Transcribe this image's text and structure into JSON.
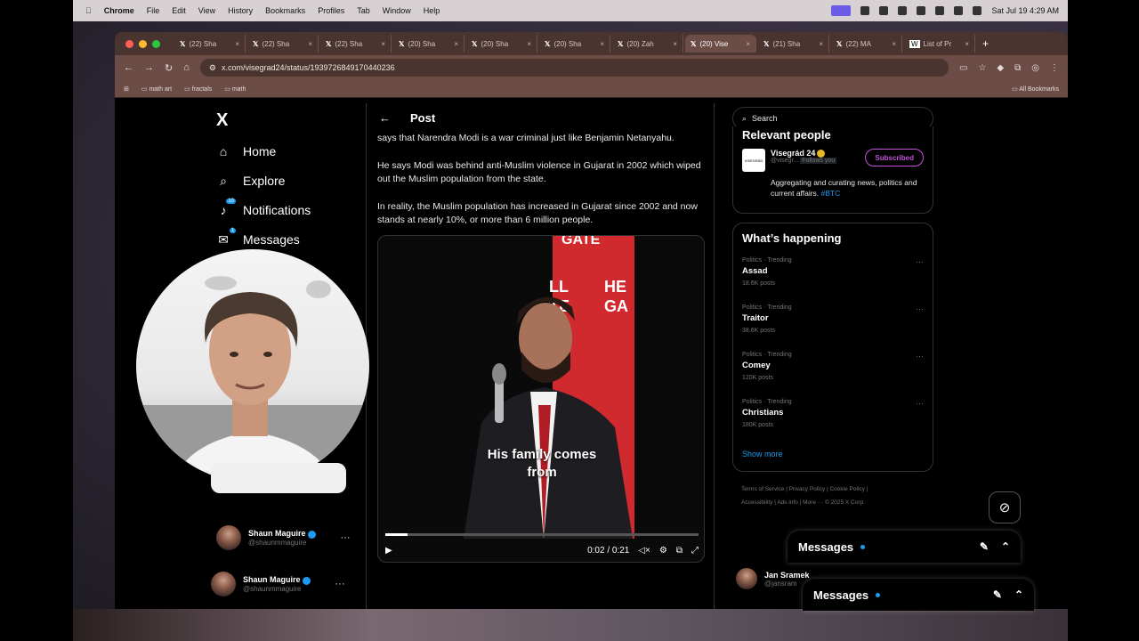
{
  "menubar": {
    "app": "Chrome",
    "items": [
      "File",
      "Edit",
      "View",
      "History",
      "Bookmarks",
      "Profiles",
      "Tab",
      "Window",
      "Help"
    ],
    "clock": "Sat Jul 19  4:29 AM"
  },
  "tabs": [
    {
      "label": "(22) Sha"
    },
    {
      "label": "(22) Sha"
    },
    {
      "label": "(22) Sha"
    },
    {
      "label": "(20) Sha"
    },
    {
      "label": "(20) Sha"
    },
    {
      "label": "(20) Sha"
    },
    {
      "label": "(20) Zah"
    },
    {
      "label": "(20) Vise"
    },
    {
      "label": "(21) Sha"
    },
    {
      "label": "(22) MA"
    },
    {
      "label": "List of Pr"
    }
  ],
  "address": {
    "url": "x.com/visegrad24/status/1939726849170440236"
  },
  "bookmarks": {
    "items": [
      "math art",
      "fractals",
      "math"
    ],
    "all": "All Bookmarks"
  },
  "nav": {
    "logo": "X",
    "home": "Home",
    "explore": "Explore",
    "notifications": "Notifications",
    "notif_badge": "10",
    "messages": "Messages",
    "msg_badge": "1"
  },
  "post": {
    "header": "Post",
    "paragraphs": [
      "says that Narendra Modi is a war criminal just like Benjamin Netanyahu.",
      "He says Modi was behind anti-Muslim violence in Gujarat in 2002 which wiped out the Muslim population from the state.",
      "In reality, the Muslim population has increased in Gujarat since 2002 and now stands at nearly 10%, or more than 6 million people."
    ],
    "video": {
      "caption_line1": "His family comes",
      "caption_line2": "from",
      "time": "0:02 / 0:21",
      "progress": 0.07,
      "banner_top": "GATE",
      "banner_left": "LL\nTE",
      "banner_right": "HE\nGA"
    }
  },
  "search": {
    "placeholder": "Search"
  },
  "relevant": {
    "title": "Relevant people",
    "name": "Visegrád 24",
    "handle": "@visegr...",
    "follows": "Follows you",
    "button": "Subscribed",
    "bio": "Aggregating and curating news, politics and current affairs.",
    "bio_tag": "#BTC"
  },
  "happening": {
    "title": "What’s happening",
    "trends": [
      {
        "category": "Politics · Trending",
        "name": "Assad",
        "posts": "18.6K posts"
      },
      {
        "category": "Politics · Trending",
        "name": "Traitor",
        "posts": "38.6K posts"
      },
      {
        "category": "Politics · Trending",
        "name": "Comey",
        "posts": "120K posts"
      },
      {
        "category": "Politics · Trending",
        "name": "Christians",
        "posts": "180K posts"
      }
    ],
    "show_more": "Show more"
  },
  "footer": {
    "line1": "Terms of Service  |  Privacy Policy  |  Cookie Policy  |",
    "line2": "Accessibility  |  Ads info  |  More ···  © 2025 X Corp."
  },
  "profile": {
    "name": "Shaun Maguire",
    "handle": "@shaunmmaguire"
  },
  "messages_drawer": {
    "label": "Messages"
  },
  "side_user": {
    "name": "Jan Sramek",
    "handle": "@jansram"
  },
  "colors": {
    "accent": "#1d9bf0",
    "subscribed": "#c053d6",
    "banner": "#d02a2f"
  }
}
